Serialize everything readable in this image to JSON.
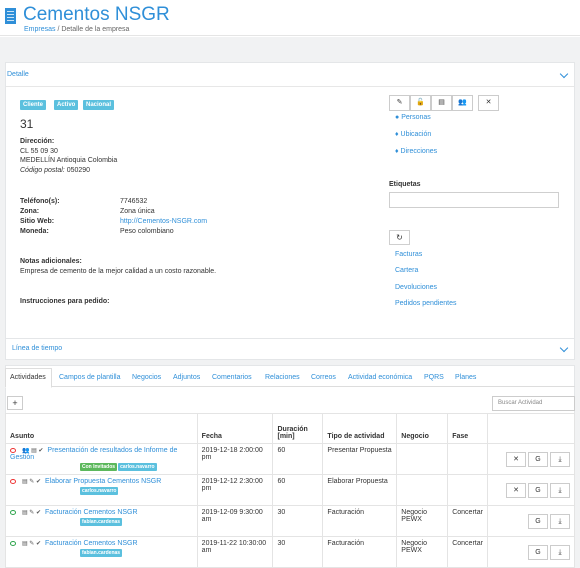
{
  "header": {
    "title": "Cementos NSGR",
    "breadcrumb": [
      "Empresas",
      "Detalle de la empresa"
    ]
  },
  "detail_card": {
    "title": "Detalle",
    "badges": [
      "Cliente",
      "Activo",
      "Nacional"
    ],
    "id": "31",
    "address_label": "Dirección:",
    "address_line1": "CL 55 09 30",
    "address_line2": "MEDELLÍN Antioquia Colombia",
    "postal_label": "Código postal:",
    "postal_code": "050290",
    "phone_label": "Teléfono(s):",
    "phone": "7746532",
    "zone_label": "Zona:",
    "zone": "Zona única",
    "web_label": "Sitio Web:",
    "web": "http://Cementos-NSGR.com",
    "currency_label": "Moneda:",
    "currency": "Peso colombiano",
    "notes_label": "Notas adicionales:",
    "notes": "Empresa de cemento de la mejor calidad a un costo razonable.",
    "instructions_label": "Instrucciones para pedido:",
    "action_buttons": [
      "✎",
      "🔓",
      "▤",
      "👥",
      "✕"
    ],
    "side_links": [
      "Personas",
      "Ubicación",
      "Direcciones"
    ],
    "tags_label": "Etiquetas",
    "refresh": "↻",
    "finance_links": [
      "Facturas",
      "Cartera",
      "Devoluciones",
      "Pedidos pendientes"
    ]
  },
  "timeline_card": {
    "title": "Línea de tiempo"
  },
  "tabs": [
    "Actividades",
    "Campos de plantilla",
    "Negocios",
    "Adjuntos",
    "Comentarios",
    "Relaciones",
    "Correos",
    "Actividad económica",
    "PQRS",
    "Planes"
  ],
  "activities": {
    "add_label": "+",
    "search_placeholder": "Buscar Actividad",
    "columns": [
      "Asunto",
      "Fecha",
      "Duración [min]",
      "Tipo de actividad",
      "Negocio",
      "Fase"
    ],
    "rows": [
      {
        "status": "red",
        "icons": "👥 ▤ ✔",
        "subject": "Presentación de resultados de Informe de Gestión",
        "tags": [
          {
            "text": "Con Invitados",
            "color": "green"
          },
          {
            "text": "carlos.navarro",
            "color": "blue"
          }
        ],
        "date": "2019-12-18 2:00:00 pm",
        "duration": "60",
        "type": "Presentar Propuesta",
        "business": "",
        "phase": "",
        "buttons": [
          "✕",
          "G",
          "⤓"
        ]
      },
      {
        "status": "red",
        "icons": "▤ ✎ ✔",
        "subject": "Elaborar Propuesta Cementos NSGR",
        "tags": [
          {
            "text": "carlos.navarro",
            "color": "blue"
          }
        ],
        "date": "2019-12-12 2:30:00 pm",
        "duration": "60",
        "type": "Elaborar Propuesta",
        "business": "",
        "phase": "",
        "buttons": [
          "✕",
          "G",
          "⤓"
        ]
      },
      {
        "status": "green",
        "icons": "▤ ✎ ✔",
        "subject": "Facturación Cementos NSGR",
        "tags": [
          {
            "text": "fabian.cardenas",
            "color": "blue"
          }
        ],
        "date": "2019-12-09 9:30:00 am",
        "duration": "30",
        "type": "Facturación",
        "business": "Negocio PEWX",
        "phase": "Concertar",
        "buttons": [
          "G",
          "⤓"
        ]
      },
      {
        "status": "green",
        "icons": "▤ ✎ ✔",
        "subject": "Facturación Cementos NSGR",
        "tags": [
          {
            "text": "fabian.cardenas",
            "color": "blue"
          }
        ],
        "date": "2019-11-22 10:30:00 am",
        "duration": "30",
        "type": "Facturación",
        "business": "Negocio PEWX",
        "phase": "Concertar",
        "buttons": [
          "G",
          "⤓"
        ]
      }
    ]
  }
}
